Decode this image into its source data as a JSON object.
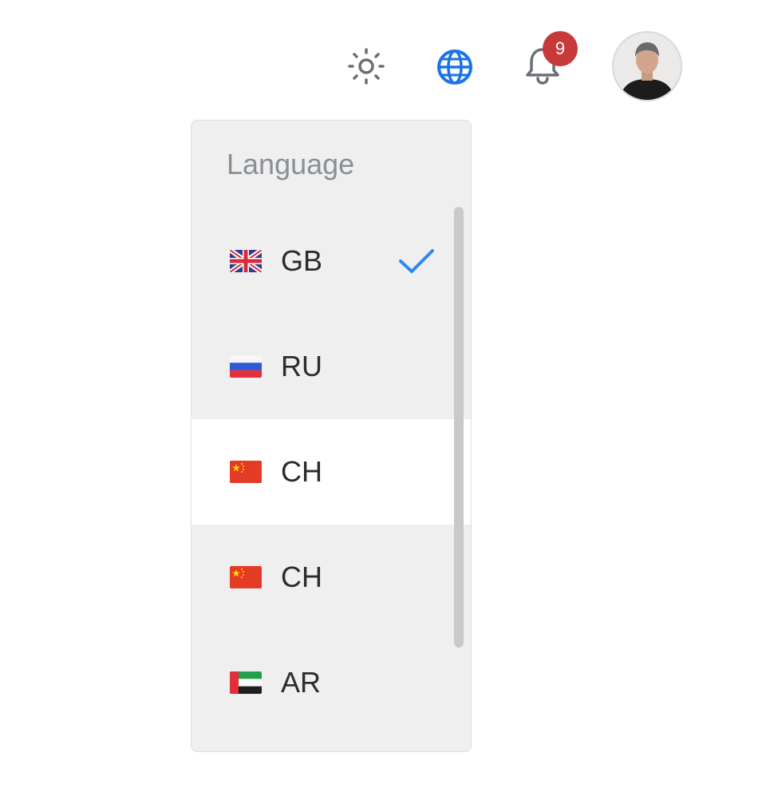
{
  "topbar": {
    "icons": [
      "sun-icon",
      "globe-icon",
      "bell-icon"
    ],
    "notifications_count": "9",
    "accent_color": "#1a73e8",
    "badge_color": "#c8393a"
  },
  "language_menu": {
    "title": "Language",
    "selected": "GB",
    "items": [
      {
        "label": "GB",
        "flag": "uk-flag-icon",
        "checked": true
      },
      {
        "label": "RU",
        "flag": "russia-flag-icon",
        "checked": false
      },
      {
        "label": "CH",
        "flag": "china-flag-icon",
        "checked": false,
        "highlighted": true
      },
      {
        "label": "CH",
        "flag": "china-flag-icon",
        "checked": false
      },
      {
        "label": "AR",
        "flag": "uae-flag-icon",
        "checked": false
      }
    ]
  }
}
